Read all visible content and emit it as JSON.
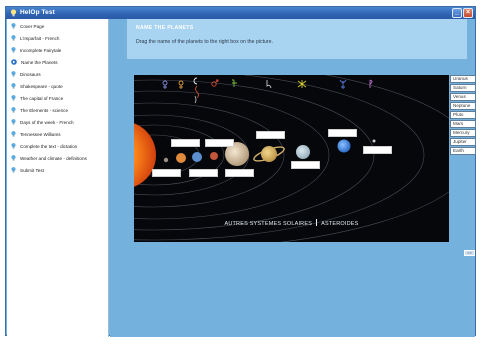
{
  "window": {
    "title": "HelOp Test"
  },
  "titlebar": {
    "minimize_label": "_",
    "close_label": "×"
  },
  "sidebar": {
    "items": [
      {
        "label": "Cover Page",
        "active": false
      },
      {
        "label": "L'imparfait - French",
        "active": false
      },
      {
        "label": "Incomplete Fairytale",
        "active": false
      },
      {
        "label": "Name the Planets",
        "active": true
      },
      {
        "label": "Dinosaurs",
        "active": false
      },
      {
        "label": "Shakespeare - quote",
        "active": false
      },
      {
        "label": "The capital of France",
        "active": false
      },
      {
        "label": "The Elements - science",
        "active": false
      },
      {
        "label": "Days of the week - French",
        "active": false
      },
      {
        "label": "Tennessee Williams",
        "active": false
      },
      {
        "label": "Complete the text - dictation",
        "active": false
      },
      {
        "label": "Weather and climate - definitions",
        "active": false
      },
      {
        "label": "Submit Test",
        "active": false
      }
    ]
  },
  "question": {
    "title": "NAME THE PLANETS",
    "instruction": "Drag the name of the planets to the right box on the picture."
  },
  "picture": {
    "caption_left": "AUTRES SYSTEMES SOLAIRES",
    "caption_right": "ASTEROIDES"
  },
  "planet_names": [
    "Uranus",
    "Saturn",
    "Venus",
    "Neptune",
    "Pluto",
    "Mars",
    "Mercury",
    "Jupiter",
    "Earth"
  ],
  "next_button": {
    "label": ">>"
  },
  "colors": {
    "window_bg": "#74b1dc",
    "header_bg": "#a8d3f1",
    "titlebar": "#2f63b4",
    "bulb": "#5aa9e0"
  }
}
